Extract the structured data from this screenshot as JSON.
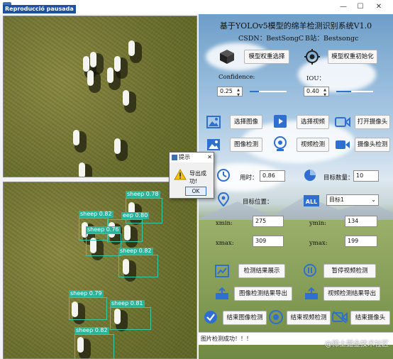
{
  "window": {
    "title": "Reproducció pausada",
    "minimize_glyph": "—",
    "maximize_glyph": "☐",
    "close_glyph": "✕"
  },
  "panel": {
    "title": "基于YOLOv5模型的绵羊检测识别系统V1.0",
    "csdn": "CSDN：BestSongC",
    "bilibili": "B站：Bestsongc"
  },
  "model": {
    "select_weights": "模型权重选择",
    "init_weights": "模型权重初始化"
  },
  "params": {
    "confidence_label": "Confidence:",
    "confidence_value": "0.25",
    "confidence_level": 0.25,
    "iou_label": "IOU：",
    "iou_value": "0.40",
    "iou_level": 0.4
  },
  "actions": {
    "select_image": "选择图像",
    "select_video": "选择视频",
    "open_camera": "打开摄像头",
    "image_detect": "图像检测",
    "video_detect": "视频检测",
    "camera_detect": "摄像头检测"
  },
  "stats": {
    "time_label": "用时：",
    "time_value": "0.86",
    "count_label": "目标数量：",
    "count_value": "10",
    "position_label": "目标位置：",
    "target_select": "目标1"
  },
  "coords": {
    "xmin_label": "xmin:",
    "xmin_value": "275",
    "ymin_label": "ymin:",
    "ymin_value": "134",
    "xmax_label": "xmax:",
    "xmax_value": "309",
    "ymax_label": "ymax:",
    "ymax_value": "199"
  },
  "bottom": {
    "show_results": "检测结果展示",
    "pause_video": "暂停视频检测",
    "export_image": "图像检测结果导出",
    "export_video": "视频检测结果导出",
    "end_image": "结束图像检测",
    "end_video": "结束视频检测",
    "end_camera": "结束摄像头"
  },
  "status_bar": "图片检测成功！！！",
  "dialog": {
    "title": "提示",
    "message": "导出成功!",
    "ok": "OK",
    "close_glyph": "✕"
  },
  "detections": {
    "labels": [
      "sheep 0.78",
      "sheep 0.82",
      "eep 0.80",
      "sheep 0.76",
      "sheep 0.82",
      "sheep 0.79",
      "sheep 0.81",
      "sheep 0.82"
    ]
  },
  "watermark": "@稀土掘金技术社区",
  "colors": {
    "detection": "#2ab398",
    "accent": "#2f6fd0"
  }
}
